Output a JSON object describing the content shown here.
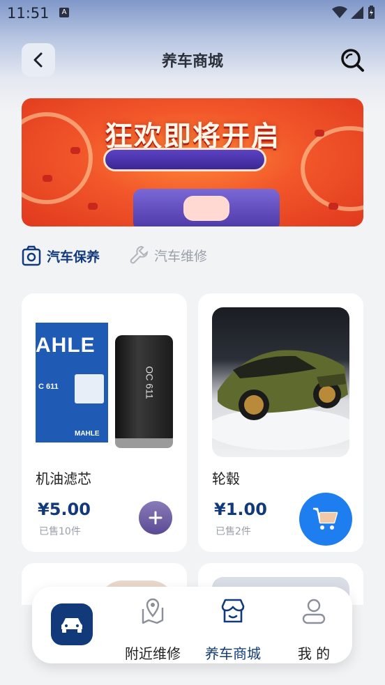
{
  "status_bar": {
    "time": "11:51",
    "notification_letter": "A"
  },
  "header": {
    "title": "养车商城"
  },
  "banner": {
    "headline": "狂欢即将开启"
  },
  "tabs": [
    {
      "label": "汽车保养",
      "active": true
    },
    {
      "label": "汽车维修",
      "active": false
    }
  ],
  "products": [
    {
      "name": "机油滤芯",
      "price": "¥5.00",
      "sold": "已售10件",
      "image_brand_text": "AHLE",
      "image_code": "C 611",
      "image_code_2": "OC 611",
      "image_logo": "MAHLE",
      "action": "plus-button"
    },
    {
      "name": "轮毂",
      "price": "¥1.00",
      "sold": "已售2件",
      "action": "cart-button"
    }
  ],
  "bottom_nav": {
    "items": [
      {
        "label": "附近维修",
        "icon": "map-pin-icon",
        "active": false
      },
      {
        "label": "养车商城",
        "icon": "store-icon",
        "active": true
      },
      {
        "label": "我 的",
        "icon": "user-icon",
        "active": false
      }
    ]
  },
  "colors": {
    "primary": "#123a7a",
    "accent_blue": "#1e7ef0",
    "muted": "#9aa0aa"
  }
}
